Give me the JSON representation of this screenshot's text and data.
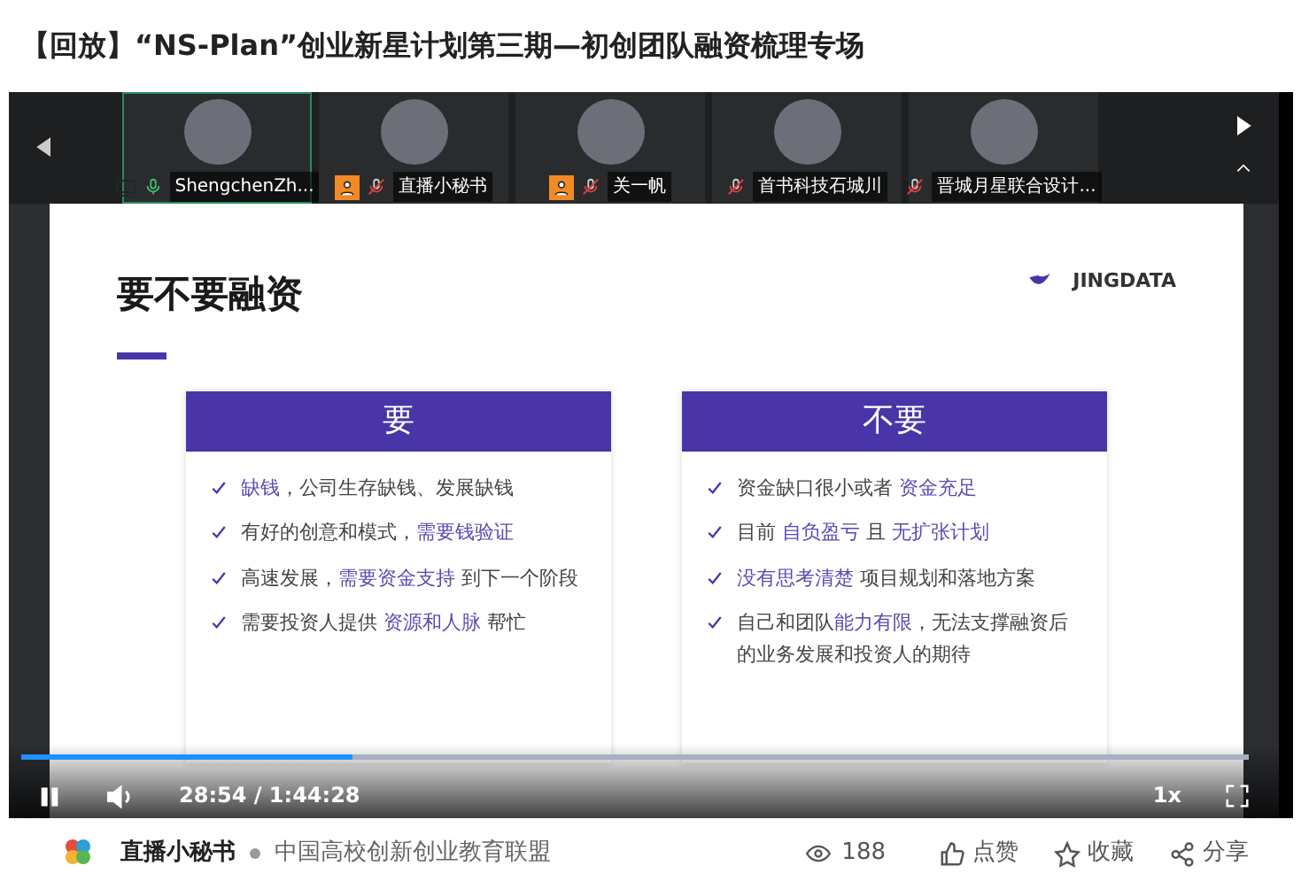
{
  "page_title": "【回放】“NS-Plan”创业新星计划第三期—初创团队融资梳理专场",
  "participants": [
    {
      "name": "ShengchenZh...",
      "kind": "screen",
      "muted": false,
      "selected": true
    },
    {
      "name": "直播小秘书",
      "kind": "guest",
      "muted": true,
      "selected": false
    },
    {
      "name": "关一帆",
      "kind": "guest",
      "muted": true,
      "selected": false
    },
    {
      "name": "首书科技石城川",
      "kind": "plain",
      "muted": true,
      "selected": false
    },
    {
      "name": "晋城月星联合设计...",
      "kind": "plain",
      "muted": true,
      "selected": false
    }
  ],
  "slide": {
    "title": "要不要融资",
    "logo_text": "JINGDATA",
    "columns": [
      {
        "heading": "要",
        "items": [
          "**缺钱**，公司生存缺钱、发展缺钱",
          "有好的创意和模式，**需要钱验证**",
          "高速发展，**需要资金支持** 到下一个阶段",
          "需要投资人提供 **资源和人脉** 帮忙"
        ]
      },
      {
        "heading": "不要",
        "items": [
          "资金缺口很小或者 **资金充足**",
          "目前 **自负盈亏** 且 **无扩张计划**",
          "**没有思考清楚** 项目规划和落地方案",
          "自己和团队**能力有限**，无法支撑融资后的业务发展和投资人的期待"
        ]
      }
    ]
  },
  "player": {
    "level": 0.27,
    "playing": true,
    "time": "28:54 / 1:44:28",
    "speed": "1x"
  },
  "footer": {
    "author": "直播小秘书",
    "organization": "中国高校创新创业教育联盟",
    "views": "188",
    "actions": [
      "点赞",
      "收藏",
      "分享"
    ]
  }
}
